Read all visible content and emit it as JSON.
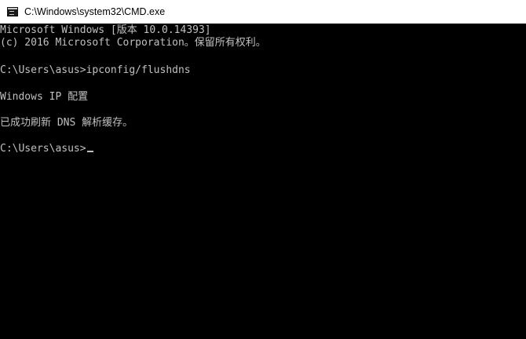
{
  "window": {
    "title": "C:\\Windows\\system32\\CMD.exe",
    "icon": "console-app-icon"
  },
  "console": {
    "lines": [
      "Microsoft Windows [版本 10.0.14393]",
      "(c) 2016 Microsoft Corporation。保留所有权利。",
      "",
      "C:\\Users\\asus>ipconfig/flushdns",
      "",
      "Windows IP 配置",
      "",
      "已成功刷新 DNS 解析缓存。",
      "",
      "C:\\Users\\asus>"
    ],
    "text_color": "#c0c0c0",
    "background_color": "#000000"
  }
}
